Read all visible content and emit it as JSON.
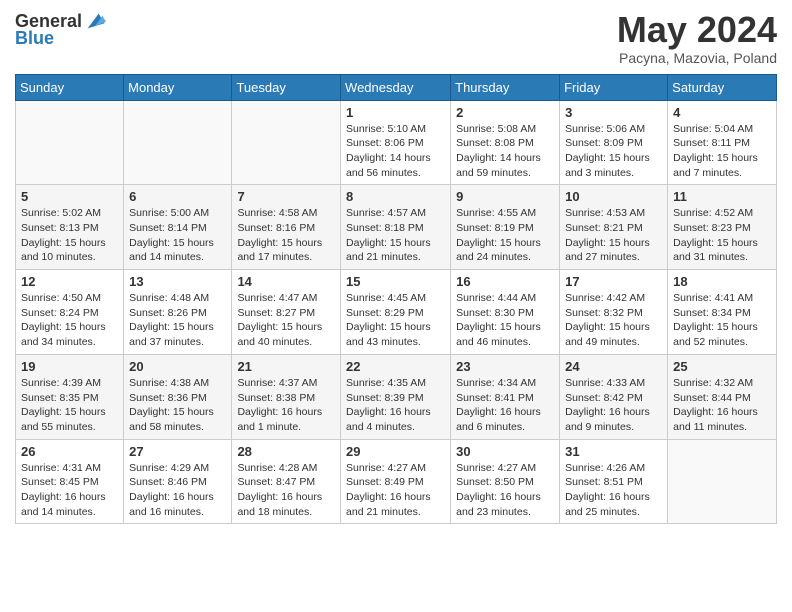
{
  "header": {
    "logo_general": "General",
    "logo_blue": "Blue",
    "month_title": "May 2024",
    "location": "Pacyna, Mazovia, Poland"
  },
  "weekdays": [
    "Sunday",
    "Monday",
    "Tuesday",
    "Wednesday",
    "Thursday",
    "Friday",
    "Saturday"
  ],
  "weeks": [
    [
      {
        "day": "",
        "sunrise": "",
        "sunset": "",
        "daylight": ""
      },
      {
        "day": "",
        "sunrise": "",
        "sunset": "",
        "daylight": ""
      },
      {
        "day": "",
        "sunrise": "",
        "sunset": "",
        "daylight": ""
      },
      {
        "day": "1",
        "sunrise": "Sunrise: 5:10 AM",
        "sunset": "Sunset: 8:06 PM",
        "daylight": "Daylight: 14 hours and 56 minutes."
      },
      {
        "day": "2",
        "sunrise": "Sunrise: 5:08 AM",
        "sunset": "Sunset: 8:08 PM",
        "daylight": "Daylight: 14 hours and 59 minutes."
      },
      {
        "day": "3",
        "sunrise": "Sunrise: 5:06 AM",
        "sunset": "Sunset: 8:09 PM",
        "daylight": "Daylight: 15 hours and 3 minutes."
      },
      {
        "day": "4",
        "sunrise": "Sunrise: 5:04 AM",
        "sunset": "Sunset: 8:11 PM",
        "daylight": "Daylight: 15 hours and 7 minutes."
      }
    ],
    [
      {
        "day": "5",
        "sunrise": "Sunrise: 5:02 AM",
        "sunset": "Sunset: 8:13 PM",
        "daylight": "Daylight: 15 hours and 10 minutes."
      },
      {
        "day": "6",
        "sunrise": "Sunrise: 5:00 AM",
        "sunset": "Sunset: 8:14 PM",
        "daylight": "Daylight: 15 hours and 14 minutes."
      },
      {
        "day": "7",
        "sunrise": "Sunrise: 4:58 AM",
        "sunset": "Sunset: 8:16 PM",
        "daylight": "Daylight: 15 hours and 17 minutes."
      },
      {
        "day": "8",
        "sunrise": "Sunrise: 4:57 AM",
        "sunset": "Sunset: 8:18 PM",
        "daylight": "Daylight: 15 hours and 21 minutes."
      },
      {
        "day": "9",
        "sunrise": "Sunrise: 4:55 AM",
        "sunset": "Sunset: 8:19 PM",
        "daylight": "Daylight: 15 hours and 24 minutes."
      },
      {
        "day": "10",
        "sunrise": "Sunrise: 4:53 AM",
        "sunset": "Sunset: 8:21 PM",
        "daylight": "Daylight: 15 hours and 27 minutes."
      },
      {
        "day": "11",
        "sunrise": "Sunrise: 4:52 AM",
        "sunset": "Sunset: 8:23 PM",
        "daylight": "Daylight: 15 hours and 31 minutes."
      }
    ],
    [
      {
        "day": "12",
        "sunrise": "Sunrise: 4:50 AM",
        "sunset": "Sunset: 8:24 PM",
        "daylight": "Daylight: 15 hours and 34 minutes."
      },
      {
        "day": "13",
        "sunrise": "Sunrise: 4:48 AM",
        "sunset": "Sunset: 8:26 PM",
        "daylight": "Daylight: 15 hours and 37 minutes."
      },
      {
        "day": "14",
        "sunrise": "Sunrise: 4:47 AM",
        "sunset": "Sunset: 8:27 PM",
        "daylight": "Daylight: 15 hours and 40 minutes."
      },
      {
        "day": "15",
        "sunrise": "Sunrise: 4:45 AM",
        "sunset": "Sunset: 8:29 PM",
        "daylight": "Daylight: 15 hours and 43 minutes."
      },
      {
        "day": "16",
        "sunrise": "Sunrise: 4:44 AM",
        "sunset": "Sunset: 8:30 PM",
        "daylight": "Daylight: 15 hours and 46 minutes."
      },
      {
        "day": "17",
        "sunrise": "Sunrise: 4:42 AM",
        "sunset": "Sunset: 8:32 PM",
        "daylight": "Daylight: 15 hours and 49 minutes."
      },
      {
        "day": "18",
        "sunrise": "Sunrise: 4:41 AM",
        "sunset": "Sunset: 8:34 PM",
        "daylight": "Daylight: 15 hours and 52 minutes."
      }
    ],
    [
      {
        "day": "19",
        "sunrise": "Sunrise: 4:39 AM",
        "sunset": "Sunset: 8:35 PM",
        "daylight": "Daylight: 15 hours and 55 minutes."
      },
      {
        "day": "20",
        "sunrise": "Sunrise: 4:38 AM",
        "sunset": "Sunset: 8:36 PM",
        "daylight": "Daylight: 15 hours and 58 minutes."
      },
      {
        "day": "21",
        "sunrise": "Sunrise: 4:37 AM",
        "sunset": "Sunset: 8:38 PM",
        "daylight": "Daylight: 16 hours and 1 minute."
      },
      {
        "day": "22",
        "sunrise": "Sunrise: 4:35 AM",
        "sunset": "Sunset: 8:39 PM",
        "daylight": "Daylight: 16 hours and 4 minutes."
      },
      {
        "day": "23",
        "sunrise": "Sunrise: 4:34 AM",
        "sunset": "Sunset: 8:41 PM",
        "daylight": "Daylight: 16 hours and 6 minutes."
      },
      {
        "day": "24",
        "sunrise": "Sunrise: 4:33 AM",
        "sunset": "Sunset: 8:42 PM",
        "daylight": "Daylight: 16 hours and 9 minutes."
      },
      {
        "day": "25",
        "sunrise": "Sunrise: 4:32 AM",
        "sunset": "Sunset: 8:44 PM",
        "daylight": "Daylight: 16 hours and 11 minutes."
      }
    ],
    [
      {
        "day": "26",
        "sunrise": "Sunrise: 4:31 AM",
        "sunset": "Sunset: 8:45 PM",
        "daylight": "Daylight: 16 hours and 14 minutes."
      },
      {
        "day": "27",
        "sunrise": "Sunrise: 4:29 AM",
        "sunset": "Sunset: 8:46 PM",
        "daylight": "Daylight: 16 hours and 16 minutes."
      },
      {
        "day": "28",
        "sunrise": "Sunrise: 4:28 AM",
        "sunset": "Sunset: 8:47 PM",
        "daylight": "Daylight: 16 hours and 18 minutes."
      },
      {
        "day": "29",
        "sunrise": "Sunrise: 4:27 AM",
        "sunset": "Sunset: 8:49 PM",
        "daylight": "Daylight: 16 hours and 21 minutes."
      },
      {
        "day": "30",
        "sunrise": "Sunrise: 4:27 AM",
        "sunset": "Sunset: 8:50 PM",
        "daylight": "Daylight: 16 hours and 23 minutes."
      },
      {
        "day": "31",
        "sunrise": "Sunrise: 4:26 AM",
        "sunset": "Sunset: 8:51 PM",
        "daylight": "Daylight: 16 hours and 25 minutes."
      },
      {
        "day": "",
        "sunrise": "",
        "sunset": "",
        "daylight": ""
      }
    ]
  ]
}
